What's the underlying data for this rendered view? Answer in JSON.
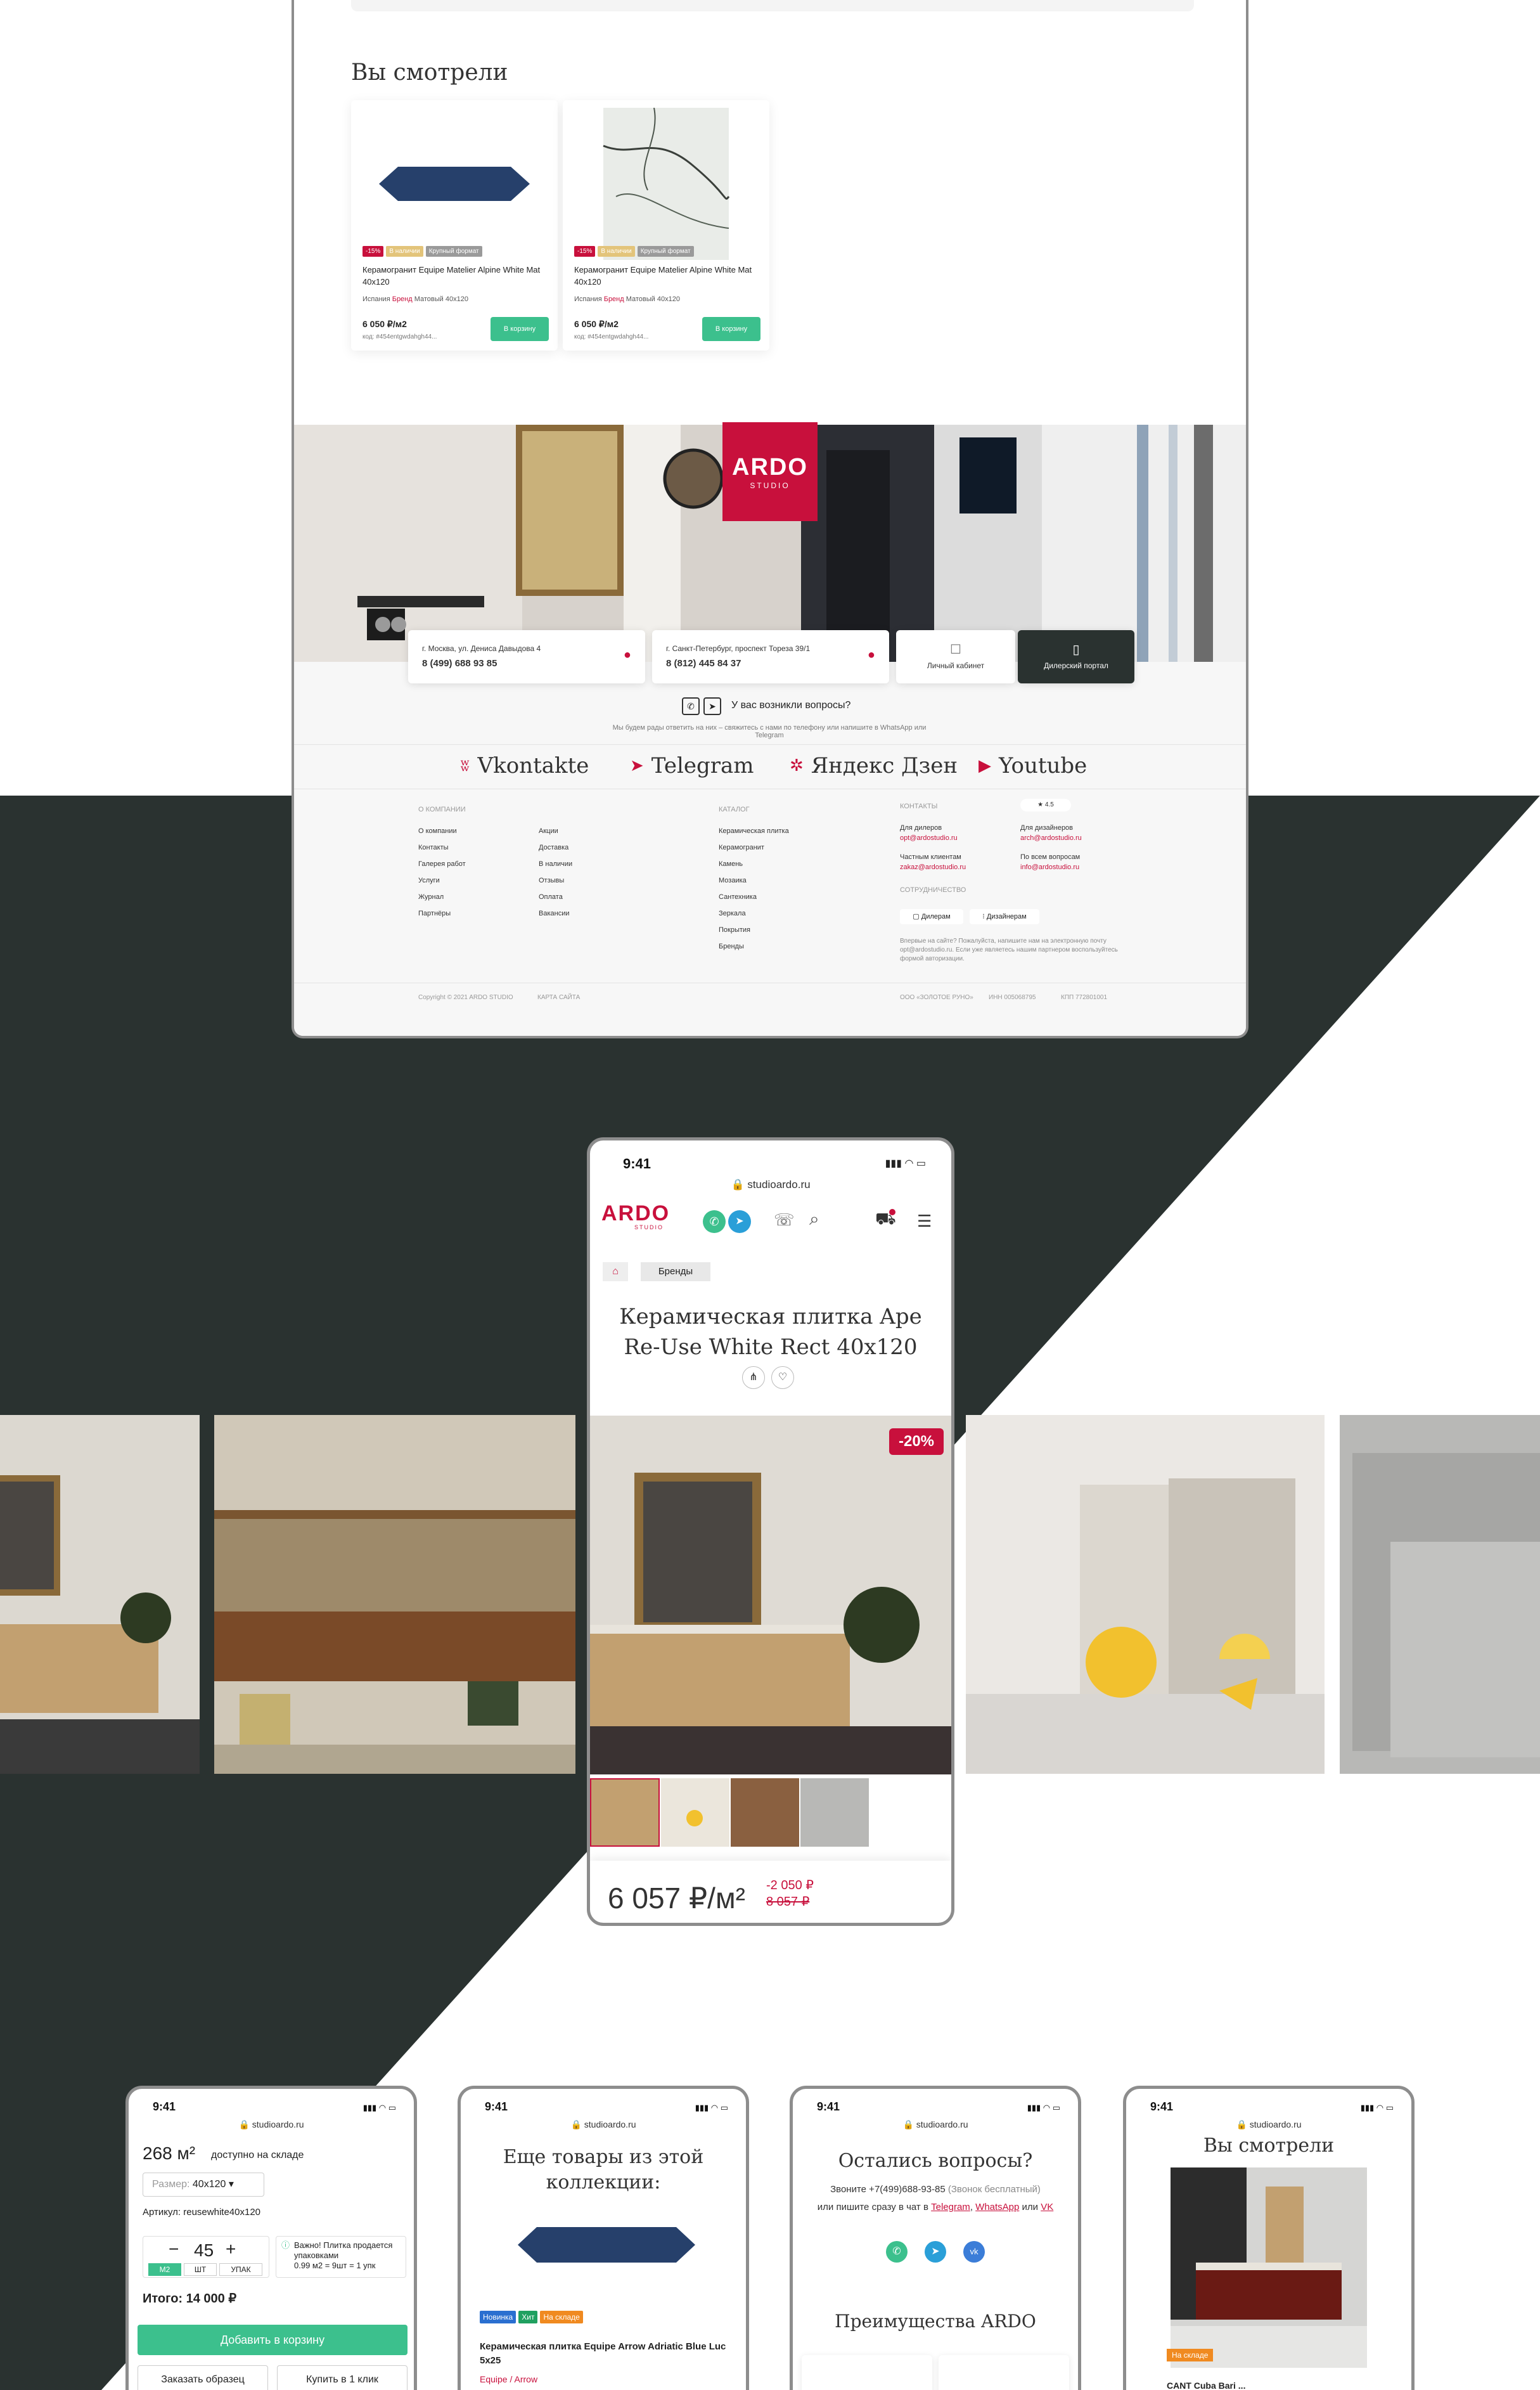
{
  "colors": {
    "dark": "#2a3230",
    "accent": "#c8103c",
    "green": "#3cc08d"
  },
  "desktop": {
    "viewed_title": "Вы смотрели",
    "products": [
      {
        "badges": [
          "-15%",
          "В наличии",
          "Крупный формат"
        ],
        "name": "Керамогранит Equipe Matelier Alpine White Mat 40x120",
        "meta_country": "Испания",
        "meta_brand": "Бренд",
        "meta_rest": "Матовый  40x120",
        "price": "6 050 ₽/м2",
        "code": "код:  #454entgwdahgh44...",
        "button": "В корзину"
      },
      {
        "badges": [
          "-15%",
          "В наличии",
          "Крупный формат"
        ],
        "name": "Керамогранит Equipe Matelier Alpine White Mat 40x120",
        "meta_country": "Испания",
        "meta_brand": "Бренд",
        "meta_rest": "Матовый  40x120",
        "price": "6 050 ₽/м2",
        "code": "код:  #454entgwdahgh44...",
        "button": "В корзину"
      }
    ],
    "logo_top": "ARDO",
    "logo_bottom": "STUDIO",
    "addr1": "г. Москва, ул. Дениса Давыдова 4",
    "phone1": "8 (499) 688 93 85",
    "addr2": "г. Санкт-Петербург, проспект Тореза 39/1",
    "phone2": "8 (812) 445 84 37",
    "cabinet": "Личный кабинет",
    "dealer_portal": "Дилерский портал",
    "question": "У вас возникли вопросы?",
    "question_sub": "Мы будем рады ответить на них – свяжитесь с нами по телефону или напишите в WhatsApp или Telegram",
    "socials": [
      "Vkontakte",
      "Telegram",
      "Яндекс Дзен",
      "Youtube"
    ],
    "footer": {
      "company_h": "О КОМПАНИИ",
      "company1": [
        "О компании",
        "Контакты",
        "Галерея работ",
        "Услуги",
        "Журнал",
        "Партнёры"
      ],
      "company2": [
        "Акции",
        "Доставка",
        "В наличии",
        "Отзывы",
        "Оплата",
        "Вакансии"
      ],
      "catalog_h": "КАТАЛОГ",
      "catalog": [
        "Керамическая плитка",
        "Керамогранит",
        "Камень",
        "Мозаика",
        "Сантехника",
        "Зеркала",
        "Покрытия",
        "Бренды"
      ],
      "contacts_h": "КОНТАКТЫ",
      "dealers": "Для дилеров",
      "dealers_mail": "opt@ardostudio.ru",
      "designers": "Для дизайнеров",
      "designers_mail": "arch@ardostudio.ru",
      "private": "Частным клиентам",
      "private_mail": "zakaz@ardostudio.ru",
      "other": "По всем вопросам",
      "other_mail": "info@ardostudio.ru",
      "rating": "4.5",
      "coop_h": "СОТРУДНИЧЕСТВО",
      "coop1": "Дилерам",
      "coop2": "Дизайнерам",
      "note": "Впервые на сайте? Пожалуйста, напишите нам на электронную почту opt@ardostudio.ru. Если уже являетесь нашим партнером воспользуйтесь формой авторизации.",
      "copyright": "Copyright © 2021 ARDO STUDIO",
      "sitemap": "КАРТА САЙТА",
      "org": "ООО «ЗОЛОТОЕ РУНО»",
      "inn": "ИНН 005068795",
      "kpp": "КПП 772801001"
    }
  },
  "mobile_main": {
    "time": "9:41",
    "url": "studioardo.ru",
    "logo": "ARDO",
    "logo_sub": "STUDIO",
    "crumb": "Бренды",
    "title_line1": "Керамическая плитка Ape",
    "title_line2": "Re-Use White Rect 40x120",
    "discount": "-20%",
    "price": "6 057 ₽/м²",
    "save": "-2 050 ₽",
    "old": "8 057 ₽"
  },
  "phone1": {
    "time": "9:41",
    "url": "studioardo.ru",
    "stock_num": "268 м²",
    "stock_text": "доступно на складе",
    "size_label": "Размер:",
    "size_val": "40x120",
    "article": "Артикул: reusewhite40x120",
    "qty": "45",
    "unit1": "М2",
    "unit2": "ШТ",
    "unit3": "УПАК",
    "note": "Важно! Плитка продается упаковками",
    "note2": "0.99 м2 = 9шт = 1 упк",
    "total": "Итого: 14 000 ₽",
    "add": "Добавить в корзину",
    "sample": "Заказать образец",
    "oneclick": "Купить в 1 клик"
  },
  "phone2": {
    "time": "9:41",
    "url": "studioardo.ru",
    "title": "Еще товары из этой коллекции:",
    "b1": "Новинка",
    "b2": "Хит",
    "b3": "На складе",
    "name": "Керамическая плитка Equipe Arrow Adriatic Blue Luc 5x25",
    "brand": "Equipe / Arrow"
  },
  "phone3": {
    "time": "9:41",
    "url": "studioardo.ru",
    "title": "Остались вопросы?",
    "line1": "Звоните +7(499)688-93-85",
    "line1b": "(Звонок бесплатный)",
    "line2": "или пишите сразу в чат в",
    "tg": "Telegram",
    "wa": "WhatsApp",
    "or": "или",
    "vk": "VK",
    "adv": "Преимущества ARDO"
  },
  "phone4": {
    "time": "9:41",
    "url": "studioardo.ru",
    "title": "Вы смотрели",
    "badge": "На складе",
    "name": "CANT Cuba Bari ..."
  }
}
